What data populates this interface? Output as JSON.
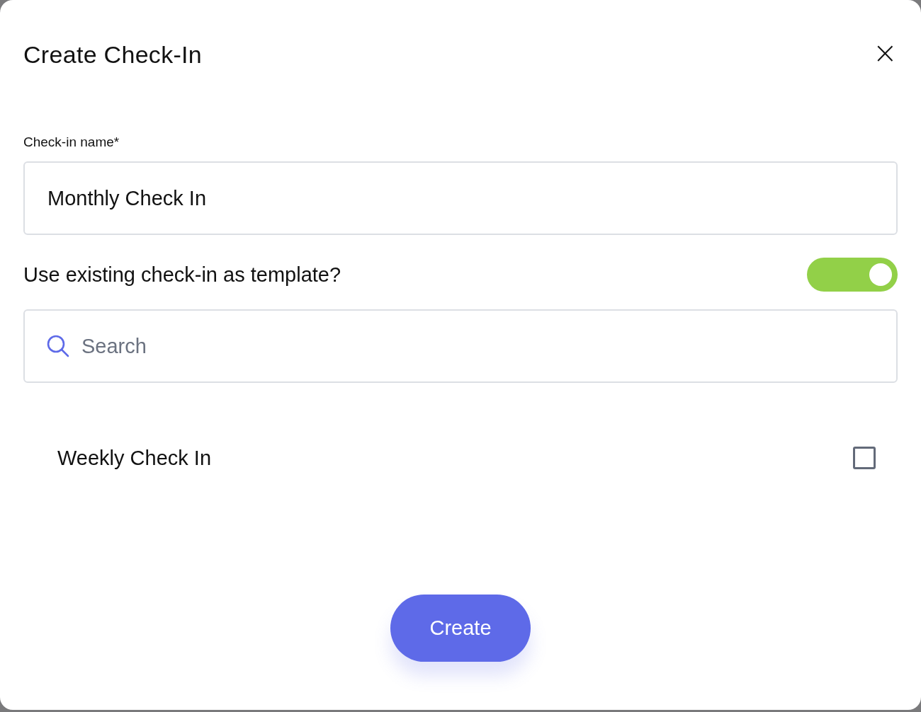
{
  "dialog": {
    "title": "Create Check-In",
    "close_label": "×"
  },
  "name_field": {
    "label": "Check-in name*",
    "value": "Monthly Check In"
  },
  "template_toggle": {
    "label": "Use existing check-in as template?",
    "on": true
  },
  "search": {
    "placeholder": "Search"
  },
  "templates": [
    {
      "name": "Weekly Check In",
      "checked": false
    }
  ],
  "buttons": [
    {
      "label": "Create"
    }
  ]
}
